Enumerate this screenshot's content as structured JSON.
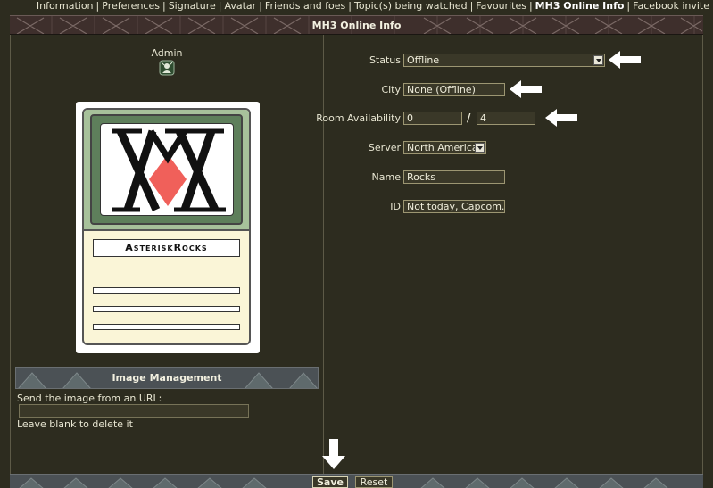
{
  "nav": {
    "items": [
      {
        "label": "Information",
        "active": false
      },
      {
        "label": "Preferences",
        "active": false
      },
      {
        "label": "Signature",
        "active": false
      },
      {
        "label": "Avatar",
        "active": false
      },
      {
        "label": "Friends and foes",
        "active": false
      },
      {
        "label": "Topic(s) being watched",
        "active": false
      },
      {
        "label": "Favourites",
        "active": false
      },
      {
        "label": "MH3 Online Info",
        "active": true
      },
      {
        "label": "Facebook invite",
        "active": false
      }
    ],
    "separator": "|"
  },
  "header": {
    "title": "MH3 Online Info"
  },
  "profile": {
    "role_label": "Admin",
    "card_name": "AsteriskRocks"
  },
  "image_management": {
    "title": "Image Management",
    "url_label": "Send the image from an URL:",
    "url_value": "",
    "hint": "Leave blank to delete it"
  },
  "form": {
    "status": {
      "label": "Status",
      "value": "Offline"
    },
    "city": {
      "label": "City",
      "value": "None (Offline)"
    },
    "room": {
      "label": "Room Availability",
      "value_from": "0",
      "separator": "/",
      "value_to": "4"
    },
    "server": {
      "label": "Server",
      "value": "North America"
    },
    "name": {
      "label": "Name",
      "value": "Rocks"
    },
    "id": {
      "label": "ID",
      "value": "Not today, Capcom."
    }
  },
  "buttons": {
    "save": "Save",
    "reset": "Reset"
  },
  "colors": {
    "background": "#2d2c1f",
    "text": "#e8e6d2",
    "header_band": "#3e2f2c",
    "section_bar": "#4b5155",
    "field_border": "#9c9672"
  }
}
